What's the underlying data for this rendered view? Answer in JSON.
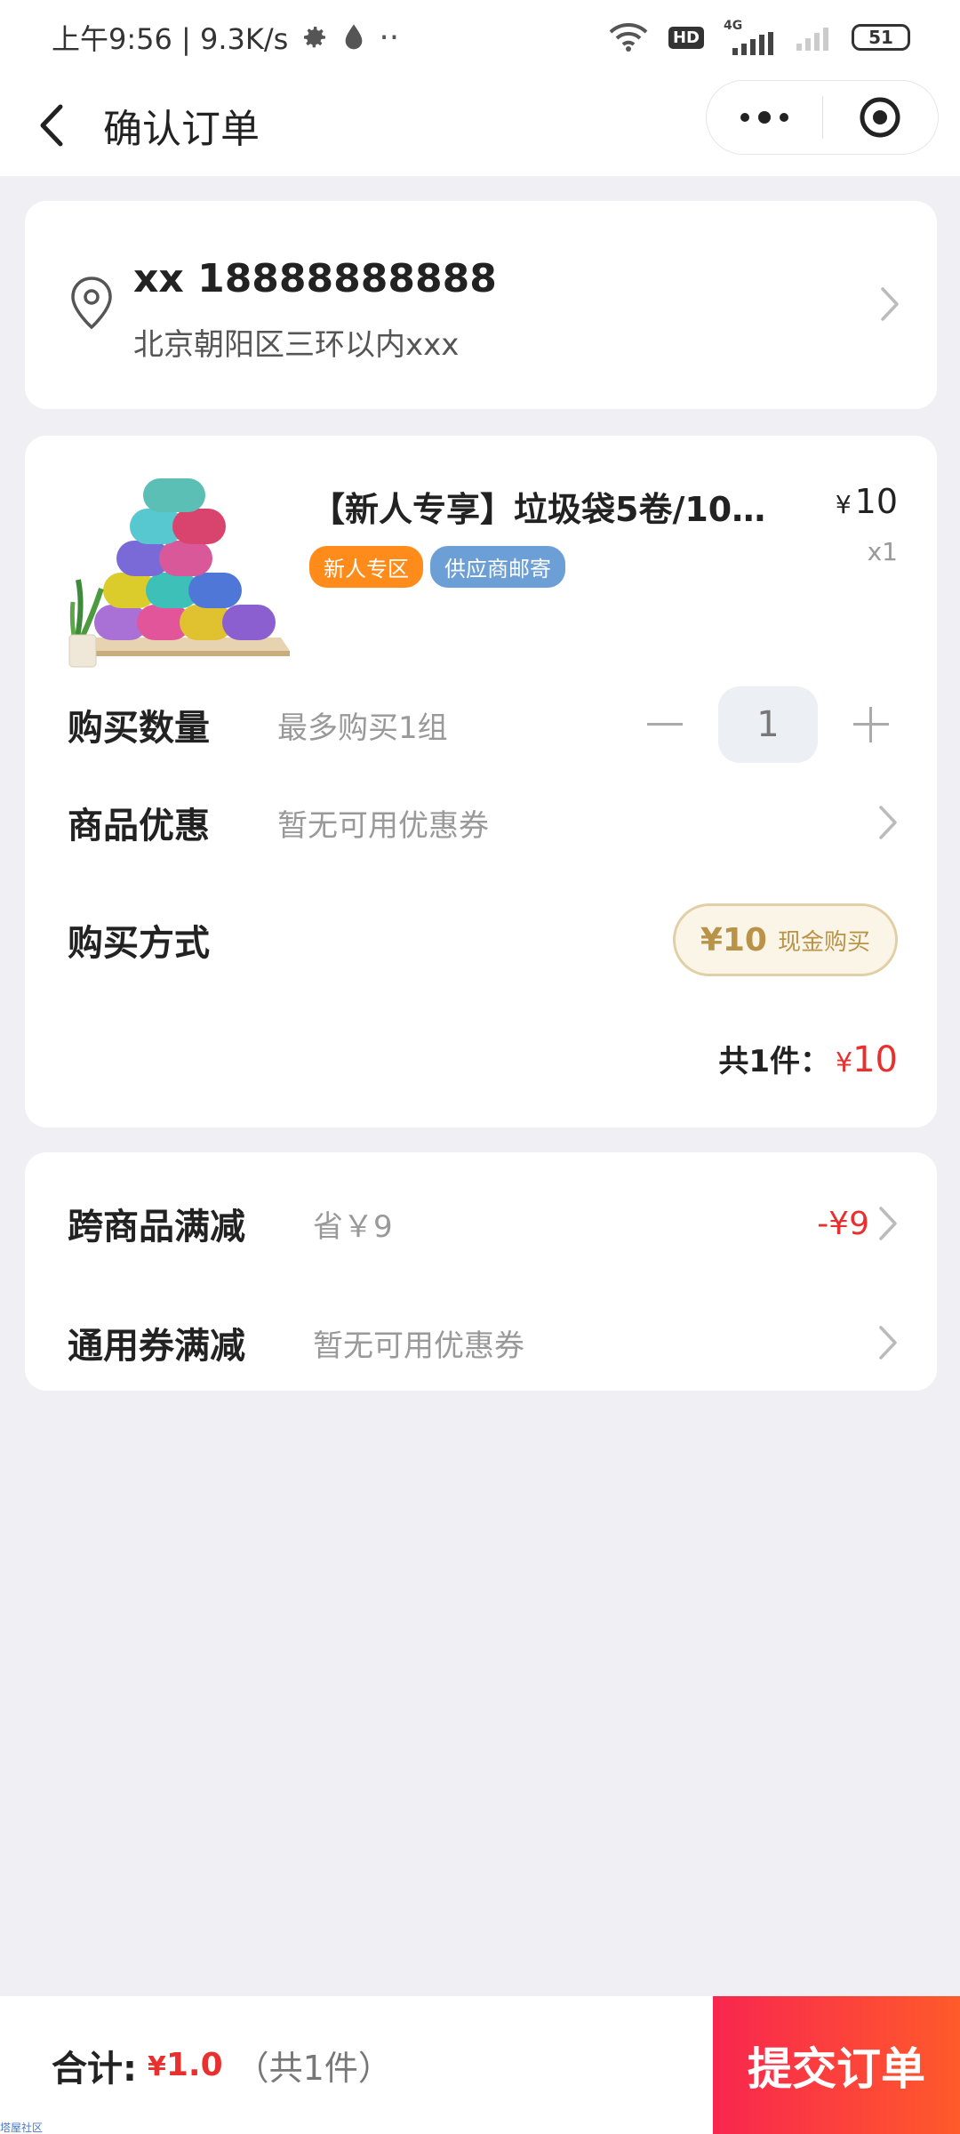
{
  "status_bar": {
    "time_speed": "上午9:56 | 9.3K/s",
    "dots": "··",
    "hd": "HD",
    "network": "4G",
    "battery": "51"
  },
  "nav": {
    "title": "确认订单",
    "more_icon": "more-dots-icon",
    "close_icon": "target-close-icon"
  },
  "address": {
    "name_phone": "xx 18888888888",
    "detail": "北京朝阳区三环以内xxx"
  },
  "product": {
    "title": "【新人专享】垃圾袋5卷/10…",
    "price": "10",
    "currency": "¥",
    "quantity": "x1",
    "tags": [
      "新人专区",
      "供应商邮寄"
    ],
    "image_icon": "garbage-bag-rolls-image"
  },
  "qty_row": {
    "label": "购买数量",
    "hint": "最多购买1组",
    "minus": "−",
    "value": "1",
    "plus": "+"
  },
  "coupon_row": {
    "label": "商品优惠",
    "hint": "暂无可用优惠券"
  },
  "method_row": {
    "label": "购买方式",
    "amount": "¥10",
    "method": "现金购买"
  },
  "subtotal": {
    "label": "共1件：",
    "currency": "¥",
    "amount": "10"
  },
  "discounts": {
    "cross_label": "跨商品满减",
    "cross_hint": "省￥9",
    "cross_amount": "-¥9",
    "general_label": "通用券满减",
    "general_hint": "暂无可用优惠券"
  },
  "bottom": {
    "total_label": "合计:",
    "currency": "¥",
    "total_amount": "1.0",
    "count": "（共1件）",
    "submit": "提交订单"
  },
  "watermark": "塔屋社区",
  "colors": {
    "accent_red": "#e8302f",
    "submit_gradient_start": "#f8264f",
    "submit_gradient_end": "#ff5a2a",
    "tag_orange": "#ff8c1a",
    "tag_blue": "#6b9fd6",
    "gold": "#b99448"
  }
}
